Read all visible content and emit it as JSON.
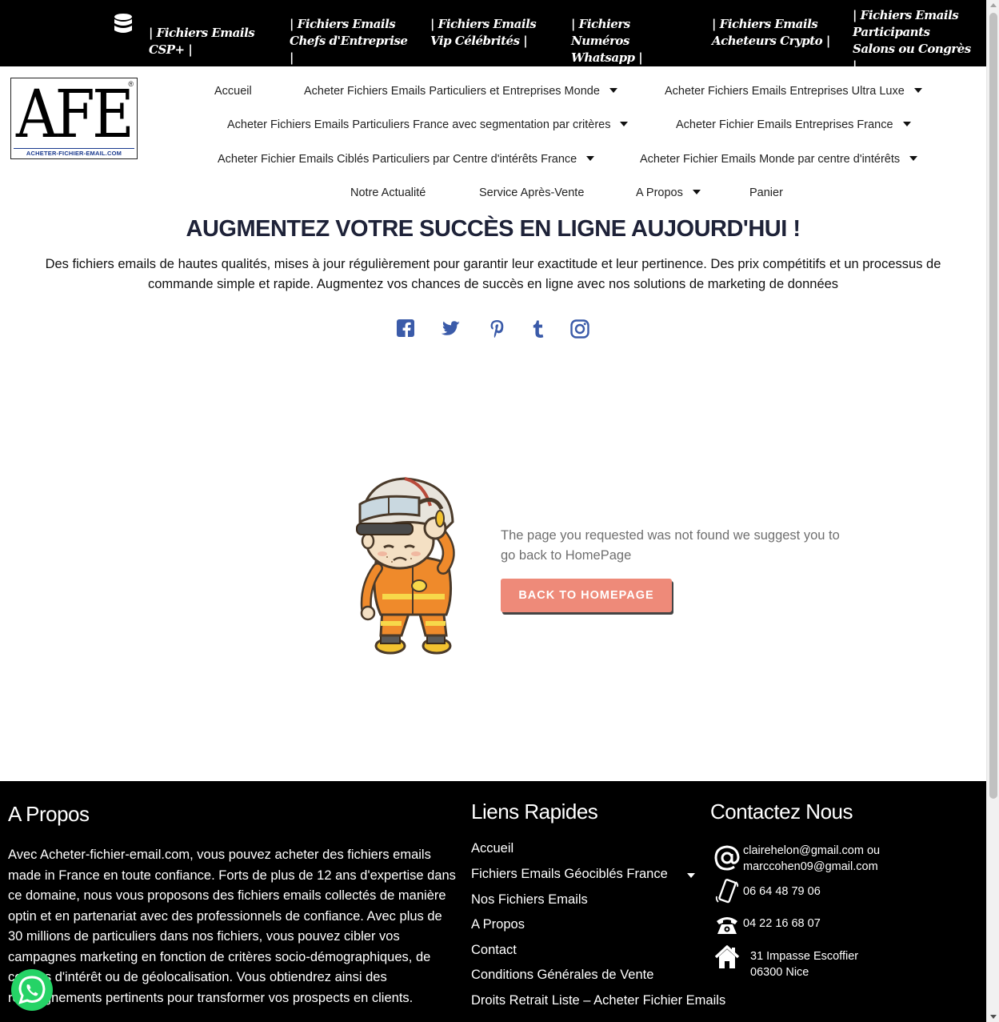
{
  "topbar": {
    "links": [
      "| Fichiers Emails  CSP+ |",
      "| Fichiers Emails Chefs d'Entreprise |",
      "| Fichiers  Emails Vip Célébrités |",
      "| Fichiers Numéros Whatsapp |",
      "| Fichiers Emails Acheteurs Crypto |",
      "| Fichiers Emails Participants Salons ou Congrès |"
    ]
  },
  "logo": {
    "letters": "AFE",
    "registered": "®",
    "subtitle": "ACHETER-FICHIER-EMAIL.COM"
  },
  "nav": {
    "items": [
      "Accueil",
      "Acheter Fichiers Emails Particuliers et Entreprises Monde",
      "Acheter Fichiers Emails Entreprises Ultra Luxe",
      "Acheter Fichiers Emails Particuliers France avec segmentation par critères",
      "Acheter Fichier Emails Entreprises France",
      "Acheter Fichier Emails Ciblés Particuliers par Centre d'intérêts France",
      "Acheter Fichier Emails Monde par centre d'intérêts",
      "Notre Actualité",
      "Service Après-Vente",
      "A Propos",
      "Panier"
    ]
  },
  "hero": {
    "title": "AUGMENTEZ VOTRE SUCCÈS EN LIGNE AUJOURD'HUI !",
    "text": "Des fichiers emails de hautes qualités, mises à jour régulièrement pour garantir leur exactitude et leur pertinence. Des prix compétitifs et un processus de commande simple et rapide. Augmentez vos chances de succès en ligne avec nos solutions de marketing de données"
  },
  "social": {
    "icons": [
      "facebook-icon",
      "twitter-icon",
      "pinterest-icon",
      "tumblr-icon",
      "instagram-icon"
    ],
    "color": "#3b5ba9"
  },
  "not_found": {
    "message": "The page you requested was not found we suggest you to go back to HomePage",
    "button": "BACK TO HOMEPAGE",
    "button_color": "#ee8a79"
  },
  "footer": {
    "about": {
      "heading": "A Propos",
      "text": "Avec Acheter-fichier-email.com, vous pouvez acheter des fichiers emails made in France en toute confiance. Forts de plus de 12 ans d'expertise dans ce domaine, nous vous proposons des fichiers emails collectés de manière optin et en partenariat avec des professionnels de confiance. Avec plus de 30 millions de particuliers dans nos fichiers, vous pouvez cibler vos campagnes marketing en fonction de critères socio-démographiques, de centres d'intérêt ou de géolocalisation. Vous obtiendrez ainsi des renseignements pertinents pour transformer vos prospects en clients."
    },
    "links": {
      "heading": "Liens Rapides",
      "items": [
        "Accueil",
        "Fichiers Emails Géociblés France",
        "Nos Fichiers Emails",
        "A Propos",
        "Contact",
        "Conditions Générales de Vente",
        "Droits Retrait Liste – Acheter Fichier Emails"
      ]
    },
    "contact": {
      "heading": "Contactez Nous",
      "email_line1": "clairehelon@gmail.com ou",
      "email_line2": "marccohen09@gmail.com",
      "mobile": "06 64 48 79 06",
      "phone": "04 22 16 68 07",
      "address_line1": "31 Impasse Escoffier",
      "address_line2": "06300 Nice"
    }
  }
}
